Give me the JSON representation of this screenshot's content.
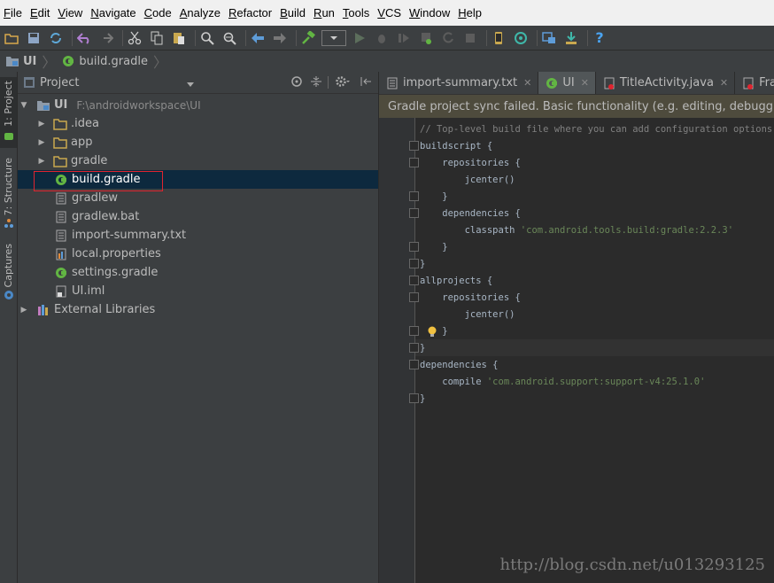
{
  "menu": [
    "File",
    "Edit",
    "View",
    "Navigate",
    "Code",
    "Analyze",
    "Refactor",
    "Build",
    "Run",
    "Tools",
    "VCS",
    "Window",
    "Help"
  ],
  "breadcrumb": {
    "root": "UI",
    "file": "build.gradle"
  },
  "left_tabs": {
    "project": "1: Project",
    "structure": "7: Structure",
    "captures": "Captures"
  },
  "project_panel": {
    "title": "Project"
  },
  "tree": {
    "root": {
      "label": "UI",
      "path": "F:\\androidworkspace\\UI"
    },
    "items": [
      ".idea",
      "app",
      "gradle",
      "build.gradle",
      "gradlew",
      "gradlew.bat",
      "import-summary.txt",
      "local.properties",
      "settings.gradle",
      "UI.iml"
    ],
    "external": "External Libraries"
  },
  "editor_tabs": [
    "import-summary.txt",
    "UI",
    "TitleActivity.java",
    "Fragmen"
  ],
  "banner": "Gradle project sync failed. Basic functionality (e.g. editing, debugging) will n",
  "code": {
    "l1": "// Top-level build file where you can add configuration options com",
    "l2": "buildscript {",
    "l3": "    repositories {",
    "l4": "        jcenter()",
    "l5": "    }",
    "l6": "    dependencies {",
    "l7a": "        classpath ",
    "l7b": "'com.android.tools.build:gradle:2.2.3'",
    "l8": "    }",
    "l9": "}",
    "l10": "allprojects {",
    "l11": "    repositories {",
    "l12": "        jcenter()",
    "l13": "    }",
    "l14": "}",
    "l15": "dependencies {",
    "l16a": "    compile ",
    "l16b": "'com.android.support:support-v4:25.1.0'",
    "l17": "}"
  },
  "watermark": "http://blog.csdn.net/u013293125",
  "colors": {
    "accent": "#0d293e",
    "highlight_box": "#e0242f",
    "gradle_icon": "#62b543",
    "folder": "#c9a84f"
  }
}
